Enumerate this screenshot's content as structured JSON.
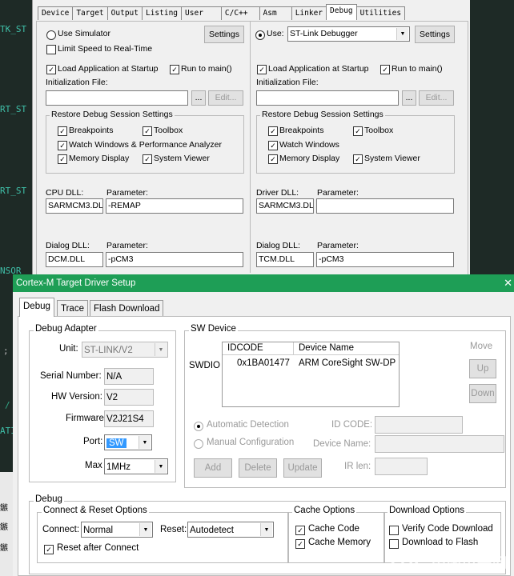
{
  "background": {
    "code_fragments": [
      "TK_ST",
      "RT_ST",
      "RT_ST",
      "NSOR",
      ";",
      "/",
      "ATI"
    ],
    "side_glyphs": [
      "鏃",
      "鏃",
      "鏃"
    ]
  },
  "options_dialog": {
    "tabs": [
      "Device",
      "Target",
      "Output",
      "Listing",
      "User",
      "C/C++",
      "Asm",
      "Linker",
      "Debug",
      "Utilities"
    ],
    "active_tab": "Debug",
    "left": {
      "use_simulator": "Use Simulator",
      "settings": "Settings",
      "limit_speed": "Limit Speed to Real-Time",
      "load_app": "Load Application at Startup",
      "run_to_main": "Run to main()",
      "init_file_label": "Initialization File:",
      "browse": "...",
      "edit": "Edit...",
      "restore_group": "Restore Debug Session Settings",
      "breakpoints": "Breakpoints",
      "toolbox": "Toolbox",
      "watch": "Watch Windows & Performance Analyzer",
      "memory": "Memory Display",
      "system_viewer": "System Viewer",
      "cpu_dll_label": "CPU DLL:",
      "cpu_param_label": "Parameter:",
      "cpu_dll": "SARMCM3.DLL",
      "cpu_param": "-REMAP",
      "dialog_dll_label": "Dialog DLL:",
      "dialog_param_label": "Parameter:",
      "dialog_dll": "DCM.DLL",
      "dialog_param": "-pCM3"
    },
    "right": {
      "use": "Use:",
      "debugger": "ST-Link Debugger",
      "settings": "Settings",
      "load_app": "Load Application at Startup",
      "run_to_main": "Run to main()",
      "init_file_label": "Initialization File:",
      "browse": "...",
      "edit": "Edit...",
      "restore_group": "Restore Debug Session Settings",
      "breakpoints": "Breakpoints",
      "toolbox": "Toolbox",
      "watch": "Watch Windows",
      "memory": "Memory Display",
      "system_viewer": "System Viewer",
      "driver_dll_label": "Driver DLL:",
      "driver_param_label": "Parameter:",
      "driver_dll": "SARMCM3.DLL",
      "driver_param": "",
      "dialog_dll_label": "Dialog DLL:",
      "dialog_param_label": "Parameter:",
      "dialog_dll": "TCM.DLL",
      "dialog_param": "-pCM3"
    }
  },
  "cortex_dialog": {
    "title": "Cortex-M Target Driver Setup",
    "close_glyph": "✕",
    "tabs": [
      "Debug",
      "Trace",
      "Flash Download"
    ],
    "adapter": {
      "group": "Debug Adapter",
      "unit_label": "Unit:",
      "unit": "ST-LINK/V2",
      "serial_label": "Serial Number:",
      "serial": "N/A",
      "hw_label": "HW Version:",
      "hw": "V2",
      "fw_label": "Firmware",
      "fw": "V2J21S4",
      "port_label": "Port:",
      "port": "SW",
      "max_label": "Max",
      "max": "1MHz"
    },
    "sw_device": {
      "group": "SW Device",
      "swdio": "SWDIO",
      "col_idcode": "IDCODE",
      "col_device": "Device Name",
      "rows": [
        {
          "idcode": "0x1BA01477",
          "device": "ARM CoreSight SW-DP"
        }
      ],
      "move": "Move",
      "up": "Up",
      "down": "Down",
      "auto": "Automatic Detection",
      "manual": "Manual Configuration",
      "id_code_label": "ID CODE:",
      "device_name_label": "Device Name:",
      "ir_len_label": "IR len:",
      "add": "Add",
      "delete": "Delete",
      "update": "Update"
    },
    "debug": {
      "group": "Debug",
      "connect_group": "Connect & Reset Options",
      "connect_label": "Connect:",
      "connect": "Normal",
      "reset_label": "Reset:",
      "reset": "Autodetect",
      "reset_after": "Reset after Connect",
      "cache_group": "Cache Options",
      "cache_code": "Cache Code",
      "cache_memory": "Cache Memory",
      "download_group": "Download Options",
      "verify": "Verify Code Download",
      "download_flash": "Download to Flash"
    },
    "watermark": "21IC 中国电子网"
  }
}
